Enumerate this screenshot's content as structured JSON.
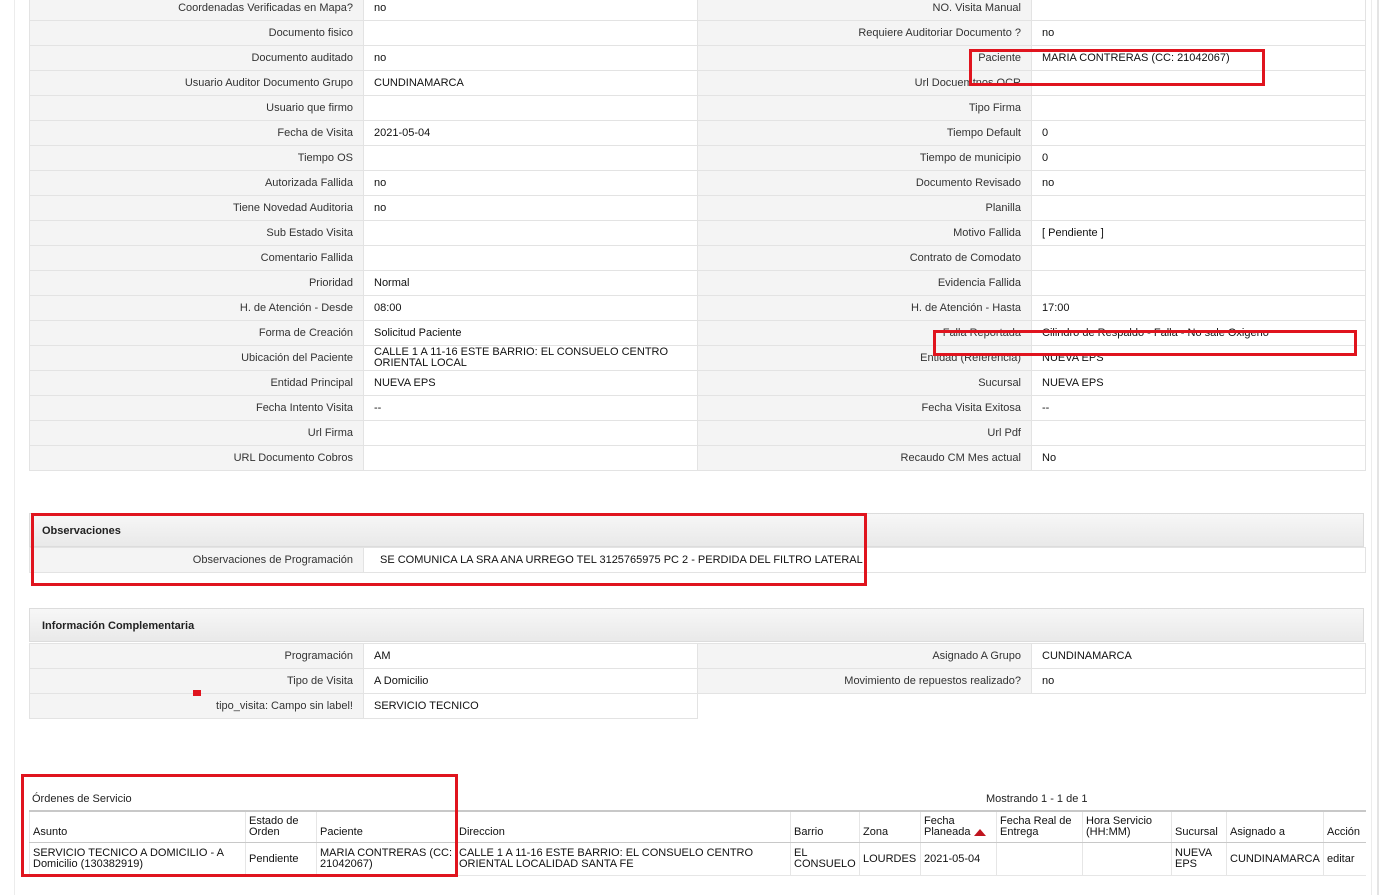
{
  "details": [
    {
      "l_label": "Coordenadas Verificadas en Mapa?",
      "l_value": "no",
      "r_label": "NO. Visita Manual",
      "r_value": ""
    },
    {
      "l_label": "Documento fisico",
      "l_value": "",
      "r_label": "Requiere Auditoriar Documento ?",
      "r_value": "no"
    },
    {
      "l_label": "Documento auditado",
      "l_value": "no",
      "r_label": "Paciente",
      "r_value": "MARIA CONTRERAS (CC: 21042067)"
    },
    {
      "l_label": "Usuario Auditor Documento Grupo",
      "l_value": "CUNDINAMARCA",
      "r_label": "Url Docuemtnos OCR",
      "r_value": ""
    },
    {
      "l_label": "Usuario que firmo",
      "l_value": "",
      "r_label": "Tipo Firma",
      "r_value": ""
    },
    {
      "l_label": "Fecha de Visita",
      "l_value": "2021-05-04",
      "r_label": "Tiempo Default",
      "r_value": "0"
    },
    {
      "l_label": "Tiempo OS",
      "l_value": "",
      "r_label": "Tiempo de municipio",
      "r_value": "0"
    },
    {
      "l_label": "Autorizada Fallida",
      "l_value": "no",
      "r_label": "Documento Revisado",
      "r_value": "no"
    },
    {
      "l_label": "Tiene Novedad Auditoria",
      "l_value": "no",
      "r_label": "Planilla",
      "r_value": ""
    },
    {
      "l_label": "Sub Estado Visita",
      "l_value": "",
      "r_label": "Motivo Fallida",
      "r_value": "[ Pendiente ]"
    },
    {
      "l_label": "Comentario Fallida",
      "l_value": "",
      "r_label": "Contrato de Comodato",
      "r_value": ""
    },
    {
      "l_label": "Prioridad",
      "l_value": "Normal",
      "r_label": "Evidencia Fallida",
      "r_value": ""
    },
    {
      "l_label": "H. de Atención - Desde",
      "l_value": "08:00",
      "r_label": "H. de Atención - Hasta",
      "r_value": "17:00"
    },
    {
      "l_label": "Forma de Creación",
      "l_value": "Solicitud Paciente",
      "r_label": "Falla Reportada",
      "r_value": "Cilindro de Respaldo - Falla - No sale Oxigeno"
    },
    {
      "l_label": "Ubicación del Paciente",
      "l_value": "CALLE 1 A 11-16 ESTE BARRIO: EL CONSUELO CENTRO ORIENTAL LOCAL",
      "r_label": "Entidad (Referencia)",
      "r_value": "NUEVA EPS"
    },
    {
      "l_label": "Entidad Principal",
      "l_value": "NUEVA EPS",
      "r_label": "Sucursal",
      "r_value": "NUEVA EPS"
    },
    {
      "l_label": "Fecha Intento Visita",
      "l_value": "--",
      "r_label": "Fecha Visita Exitosa",
      "r_value": "--"
    },
    {
      "l_label": "Url Firma",
      "l_value": "",
      "r_label": "Url Pdf",
      "r_value": ""
    },
    {
      "l_label": "URL Documento Cobros",
      "l_value": "",
      "r_label": "Recaudo CM Mes actual",
      "r_value": "No"
    }
  ],
  "observaciones": {
    "title": "Observaciones",
    "label": "Observaciones de Programación",
    "value": "SE COMUNICA LA SRA ANA URREGO TEL 3125765975 PC 2 - PERDIDA DEL FILTRO LATERAL"
  },
  "complementaria": {
    "title": "Información Complementaria",
    "programacion_label": "Programación",
    "programacion_value": "AM",
    "grupo_label": "Asignado A Grupo",
    "grupo_value": "CUNDINAMARCA",
    "tipo_label": "Tipo de Visita",
    "tipo_value": "A Domicilio",
    "repuestos_label": "Movimiento de repuestos realizado?",
    "repuestos_value": "no",
    "tipo_visita_label": "tipo_visita: Campo sin label!",
    "tipo_visita_value": "SERVICIO TECNICO"
  },
  "orders": {
    "title": "Órdenes de Servicio",
    "count": "Mostrando 1 - 1 de 1",
    "headers": {
      "asunto": "Asunto",
      "estado": "Estado de Orden",
      "paciente": "Paciente",
      "direccion": "Direccion",
      "barrio": "Barrio",
      "zona": "Zona",
      "fecha_planeada": "Fecha Planeada",
      "fecha_real": "Fecha Real de Entrega",
      "hora": "Hora Servicio (HH:MM)",
      "sucursal": "Sucursal",
      "asignado": "Asignado a",
      "accion": "Acción"
    },
    "row": {
      "asunto": "SERVICIO TECNICO A DOMICILIO - A Domicilio (130382919)",
      "estado": "Pendiente",
      "paciente": "MARIA CONTRERAS (CC: 21042067)",
      "direccion": "CALLE 1 A 11-16 ESTE BARRIO: EL CONSUELO CENTRO ORIENTAL LOCALIDAD SANTA FE",
      "barrio": "EL CONSUELO",
      "zona": "LOURDES",
      "fecha_planeada": "2021-05-04",
      "fecha_real": "",
      "hora": "",
      "sucursal": "NUEVA EPS",
      "asignado": "CUNDINAMARCA",
      "accion": "editar"
    }
  },
  "colors": {
    "highlight_border": "#e0141e",
    "sort_arrow": "#c0141e"
  }
}
